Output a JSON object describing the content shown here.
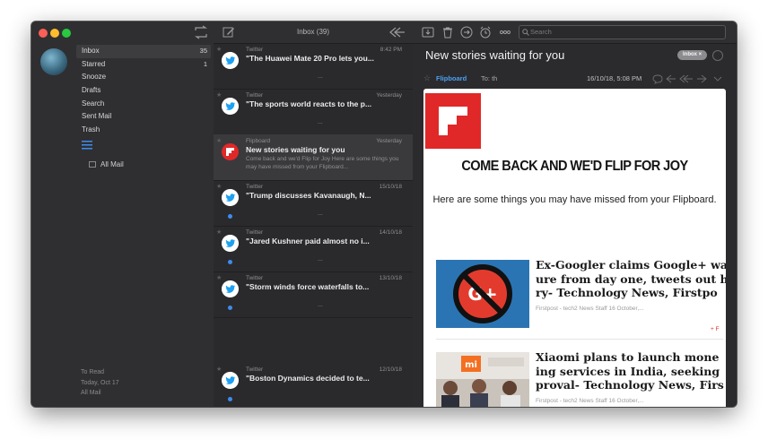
{
  "sidebar": {
    "items": [
      {
        "label": "Inbox",
        "count": "35",
        "active": true
      },
      {
        "label": "Starred",
        "count": "1"
      },
      {
        "label": "Snooze",
        "count": ""
      },
      {
        "label": "Drafts",
        "count": ""
      },
      {
        "label": "Search",
        "count": ""
      },
      {
        "label": "Sent Mail",
        "count": ""
      },
      {
        "label": "Trash",
        "count": ""
      }
    ],
    "all_mail": "All Mail",
    "footer": [
      "To Read",
      "Today, Oct 17",
      "All Mail"
    ]
  },
  "list": {
    "title": "Inbox (39)",
    "messages": [
      {
        "from": "Twitter",
        "time": "8:42 PM",
        "subject": "\"The Huawei Mate 20 Pro lets you...",
        "preview": "",
        "dots": "...",
        "unread": false,
        "icon": "twitter-icon"
      },
      {
        "from": "Twitter",
        "time": "Yesterday",
        "subject": "\"The sports world reacts to the p...",
        "preview": "",
        "dots": "...",
        "unread": false,
        "icon": "twitter-icon"
      },
      {
        "from": "Flipboard",
        "time": "Yesterday",
        "subject": "New stories waiting for you",
        "preview": "Come back and we'd Flip for Joy Here are some things you may have missed from your Flipboard...",
        "dots": "",
        "unread": false,
        "icon": "flipboard-icon",
        "selected": true
      },
      {
        "from": "Twitter",
        "time": "15/10/18",
        "subject": "\"Trump discusses Kavanaugh, N...",
        "preview": "",
        "dots": "...",
        "unread": true,
        "icon": "twitter-icon"
      },
      {
        "from": "Twitter",
        "time": "14/10/18",
        "subject": "\"Jared Kushner paid almost no i...",
        "preview": "",
        "dots": "...",
        "unread": true,
        "icon": "twitter-icon"
      },
      {
        "from": "Twitter",
        "time": "13/10/18",
        "subject": "\"Storm winds force waterfalls to...",
        "preview": "",
        "dots": "...",
        "unread": true,
        "icon": "twitter-icon"
      },
      {
        "from": "Twitter",
        "time": "12/10/18",
        "subject": "\"Boston Dynamics decided to te...",
        "preview": "",
        "dots": "",
        "unread": true,
        "icon": "twitter-icon"
      }
    ]
  },
  "reader": {
    "search_placeholder": "Search",
    "title": "New stories waiting for you",
    "badge": "Inbox ×",
    "sender": "Flipboard",
    "to": "To: th",
    "date": "16/10/18, 5:08 PM",
    "email": {
      "headline": "COME BACK AND WE'D FLIP FOR JOY",
      "intro": "Here are some things you may have missed from your Flipboard.",
      "articles": [
        {
          "title_lines": [
            "Ex-Googler claims Google+ wa",
            "ure from day one, tweets out h",
            "ry- Technology News, Firstpo"
          ],
          "source": "Firstpost - tech2 News Staff 16 October,...",
          "more": "+ F"
        },
        {
          "title_lines": [
            "Xiaomi plans to launch mone",
            "ing services in India, seeking",
            "proval- Technology News, Firs"
          ],
          "source": "Firstpost - tech2 News Staff 16 October,...",
          "more": ""
        }
      ]
    }
  },
  "colors": {
    "accent_blue": "#3d8cf0",
    "flipboard_red": "#e12828",
    "twitter_blue": "#1da1f2"
  }
}
